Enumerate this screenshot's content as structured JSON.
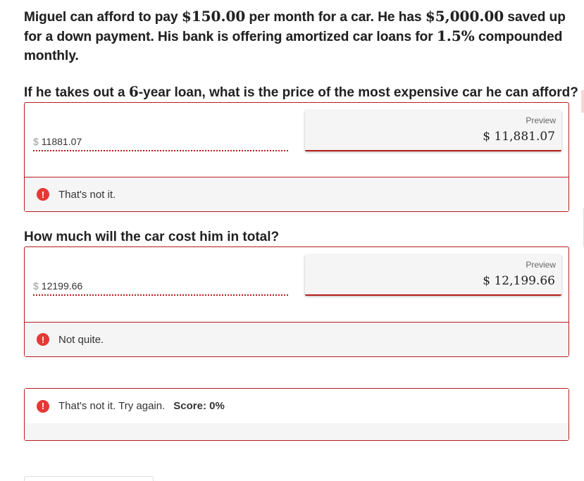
{
  "intro": {
    "p1": "Miguel can afford to pay ",
    "m1": "$150.00",
    "p2": " per month for a car. He has ",
    "m2": "$5,000.00",
    "p3": " saved up for a down payment. His bank is offering amortized car loans for ",
    "m3": "1.5%",
    "p4": " compounded monthly."
  },
  "q1": {
    "t1": "If he takes out a ",
    "m": "6",
    "t2": "-year loan, what is the price of the most expensive car he can afford?"
  },
  "q2": {
    "text": "How much will the car cost him in total?"
  },
  "answer1": {
    "currency": "$",
    "value": "11881.07",
    "preview_label": "Preview",
    "preview_value": "$ 11,881.07",
    "feedback": "That's not it."
  },
  "answer2": {
    "currency": "$",
    "value": "12199.66",
    "preview_label": "Preview",
    "preview_value": "$ 12,199.66",
    "feedback": "Not quite."
  },
  "summary": {
    "feedback": "That's not it. Try again.",
    "score": "Score: 0%"
  },
  "icons": {
    "alert": "!"
  },
  "colors": {
    "accent": "#b71c1c",
    "alert": "#e53935",
    "panel_bg": "#f5f5f5"
  }
}
